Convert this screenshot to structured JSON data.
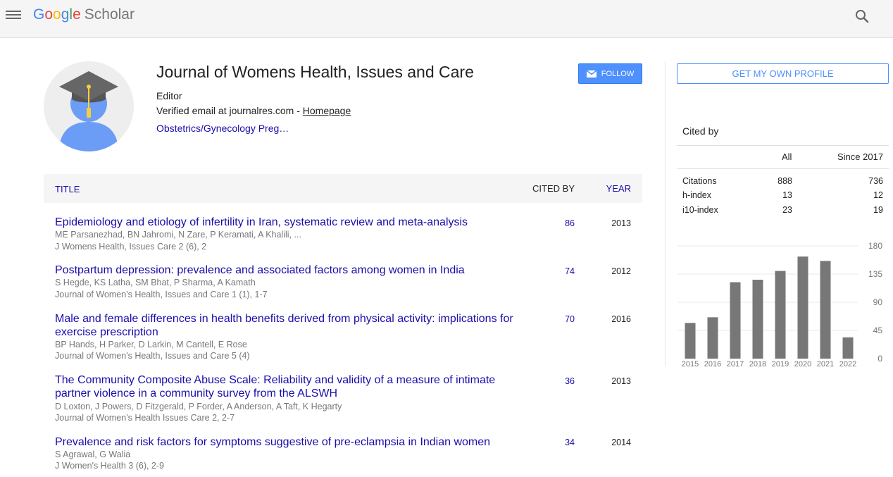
{
  "header": {
    "logo": {
      "g1": "G",
      "g2": "o",
      "g3": "o",
      "g4": "g",
      "g5": "l",
      "g6": "e",
      "scholar": "Scholar"
    },
    "icons": {
      "menu": "menu-icon",
      "search": "search-icon"
    }
  },
  "profile": {
    "name": "Journal of Womens Health, Issues and Care",
    "role": "Editor",
    "email_text": "Verified email at journalres.com - ",
    "homepage": "Homepage",
    "interest": "Obstetrics/Gynecology Preg…",
    "follow_label": "FOLLOW"
  },
  "table": {
    "headers": {
      "title": "TITLE",
      "cited_by": "CITED BY",
      "year": "YEAR"
    },
    "rows": [
      {
        "title": "Epidemiology and etiology of infertility in Iran, systematic review and meta-analysis",
        "authors": "ME Parsanezhad, BN Jahromi, N Zare, P Keramati, A Khalili, ...",
        "venue": "J Womens Health, Issues Care 2 (6), 2",
        "cited": "86",
        "year": "2013"
      },
      {
        "title": "Postpartum depression: prevalence and associated factors among women in India",
        "authors": "S Hegde, KS Latha, SM Bhat, P Sharma, A Kamath",
        "venue": "Journal of Women's Health, Issues and Care 1 (1), 1-7",
        "cited": "74",
        "year": "2012"
      },
      {
        "title": "Male and female differences in health benefits derived from physical activity: implications for exercise prescription",
        "authors": "BP Hands, H Parker, D Larkin, M Cantell, E Rose",
        "venue": "Journal of Women's Health, Issues and Care 5 (4)",
        "cited": "70",
        "year": "2016"
      },
      {
        "title": "The Community Composite Abuse Scale: Reliability and validity of a measure of intimate partner violence in a community survey from the ALSWH",
        "authors": "D Loxton, J Powers, D Fitzgerald, P Forder, A Anderson, A Taft, K Hegarty",
        "venue": "Journal of Women's Health Issues Care 2, 2-7",
        "cited": "36",
        "year": "2013"
      },
      {
        "title": "Prevalence and risk factors for symptoms suggestive of pre-eclampsia in Indian women",
        "authors": "S Agrawal, G Walia",
        "venue": "J Women's Health 3 (6), 2-9",
        "cited": "34",
        "year": "2014"
      }
    ]
  },
  "sidebar": {
    "get_profile_label": "GET MY OWN PROFILE",
    "cited_by_label": "Cited by",
    "col_all": "All",
    "col_since": "Since 2017",
    "stats": [
      {
        "label": "Citations",
        "all": "888",
        "since": "736"
      },
      {
        "label": "h-index",
        "all": "13",
        "since": "12"
      },
      {
        "label": "i10-index",
        "all": "23",
        "since": "19"
      }
    ]
  },
  "chart_data": {
    "type": "bar",
    "categories": [
      "2015",
      "2016",
      "2017",
      "2018",
      "2019",
      "2020",
      "2021",
      "2022"
    ],
    "values": [
      57,
      66,
      122,
      126,
      140,
      163,
      156,
      34
    ],
    "yticks": [
      0,
      45,
      90,
      135,
      180
    ],
    "ylim": [
      0,
      180
    ],
    "bar_color": "#777777",
    "grid": true
  }
}
